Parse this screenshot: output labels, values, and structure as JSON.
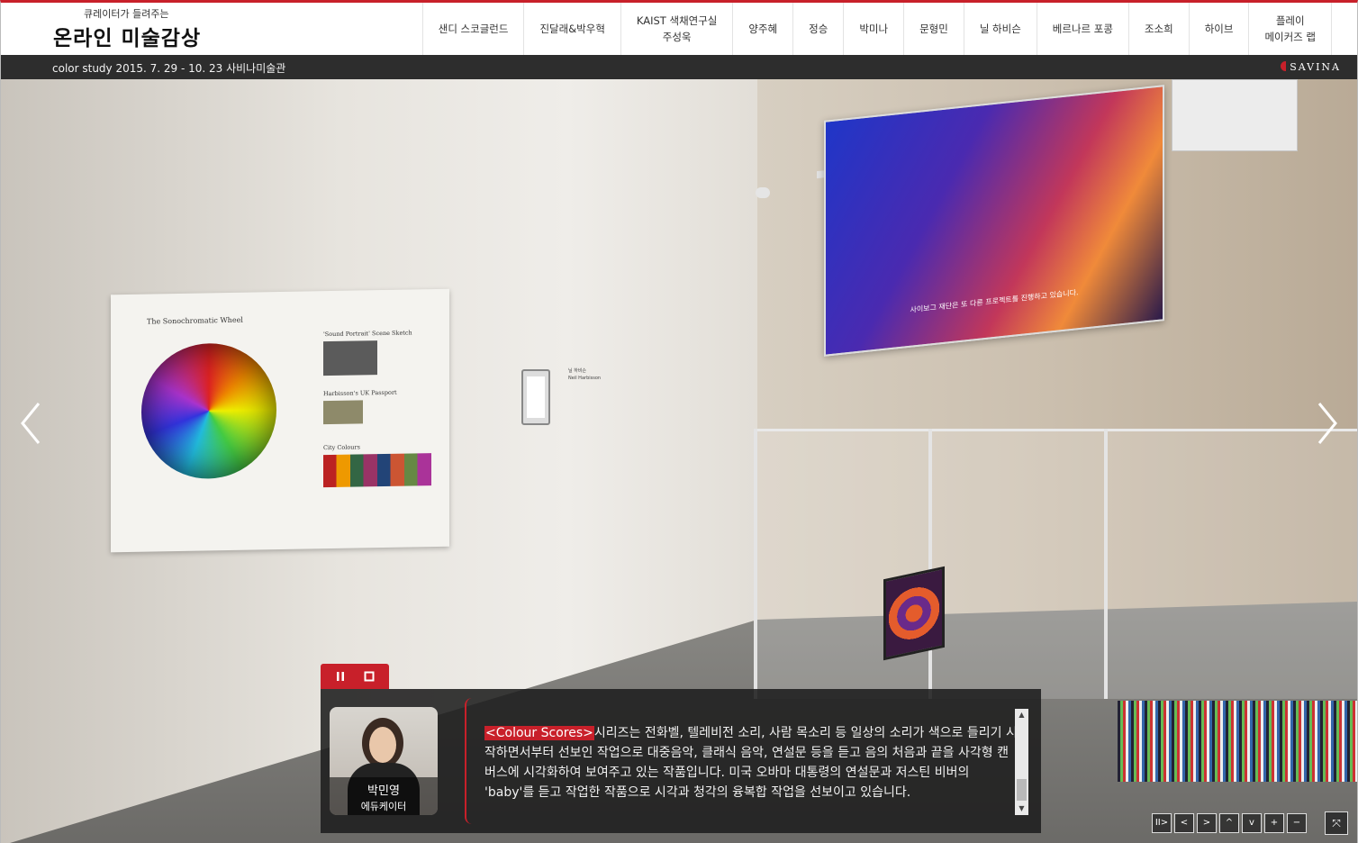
{
  "header": {
    "logo_sub": "큐레이터가 들려주는",
    "logo_main": "온라인 미술감상",
    "nav": [
      "샌디 스코글런드",
      "진달래&박우혁",
      "KAIST 색채연구실\n주성욱",
      "양주혜",
      "정승",
      "박미나",
      "문형민",
      "닐 하비슨",
      "베르나르 포콩",
      "조소희",
      "하이브",
      "플레이\n메이커즈 랩"
    ]
  },
  "infobar": {
    "exhibition": "color study 2015. 7. 29 - 10. 23 사비나미술관",
    "brand": "SAVINA"
  },
  "scene": {
    "panel_title": "The Sonochromatic Wheel",
    "panel_sections": [
      "'Sound Portrait' Scene Sketch",
      "Harbisson's UK Passport",
      "City Colours"
    ],
    "wall_label_title": "닐 하비슨",
    "wall_label_sub": "Neil Harbisson",
    "screen_subtitle": "사이보그 재단은 또 다른 프로젝트를 진행하고 있습니다."
  },
  "narration": {
    "presenter_name": "박민영",
    "presenter_role": "에듀케이터",
    "highlight": "<Colour Scores>",
    "text": "시리즈는 전화벨, 텔레비전 소리, 사람 목소리 등 일상의 소리가 색으로 들리기 시작하면서부터 선보인 작업으로 대중음악, 클래식 음악, 연설문 등을 듣고 음의 처음과 끝을 사각형 캔버스에 시각화하여 보여주고 있는 작품입니다. 미국 오바마 대통령의 연설문과 저스틴 비버의 'baby'를 듣고 작업한 작품으로 시각과 청각의 융복합 작업을 선보이고 있습니다."
  },
  "controls": {
    "pause_icon": "pause-icon",
    "stop_icon": "stop-icon",
    "viewer": [
      "autoplay",
      "left",
      "right",
      "up",
      "down",
      "zoom-in",
      "zoom-out"
    ],
    "viewer_glyphs": [
      "II>",
      "<",
      ">",
      "^",
      "v",
      "+",
      "−"
    ],
    "fullscreen_glyph": "⤧"
  },
  "colors": {
    "accent": "#c8202a",
    "infobar_bg": "#2d2d2d",
    "narration_bg": "#1e1e1e"
  }
}
